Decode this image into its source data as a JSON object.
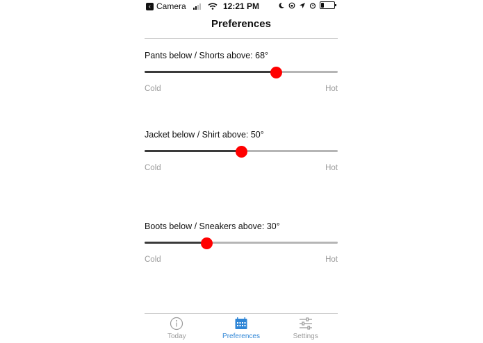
{
  "status_bar": {
    "back_app": "Camera",
    "time": "12:21 PM",
    "battery_level": 0.25
  },
  "nav": {
    "title": "Preferences"
  },
  "preferences": [
    {
      "label": "Pants below / Shorts above: 68°",
      "value": 0.68,
      "low": "Cold",
      "high": "Hot"
    },
    {
      "label": "Jacket below / Shirt above: 50°",
      "value": 0.5,
      "low": "Cold",
      "high": "Hot"
    },
    {
      "label": "Boots below / Sneakers above: 30°",
      "value": 0.32,
      "low": "Cold",
      "high": "Hot"
    }
  ],
  "tabs": [
    {
      "label": "Today",
      "icon": "info-icon",
      "active": false
    },
    {
      "label": "Preferences",
      "icon": "calendar-icon",
      "active": true
    },
    {
      "label": "Settings",
      "icon": "sliders-icon",
      "active": false
    }
  ],
  "colors": {
    "accent": "#2f86d6",
    "thumb": "#ff0000",
    "track_filled": "#3a3a3a",
    "track_empty": "#b5b5b5"
  }
}
